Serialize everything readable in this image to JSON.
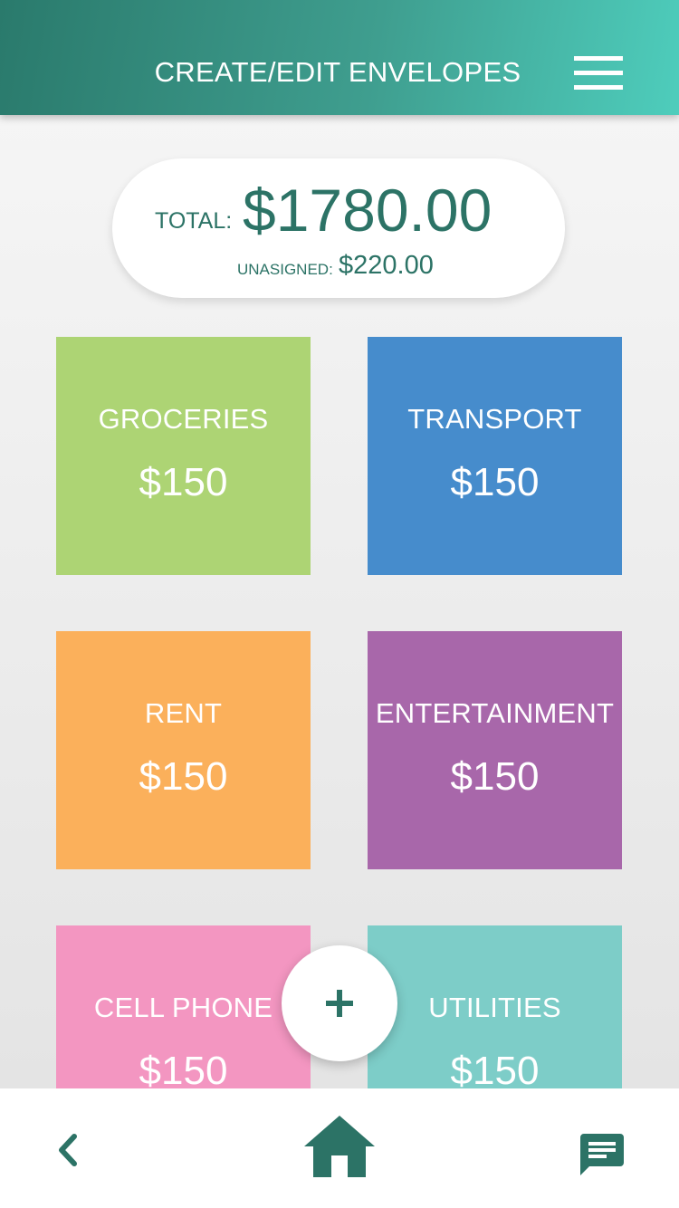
{
  "header": {
    "title": "CREATE/EDIT ENVELOPES",
    "menu_icon": "hamburger-menu-icon"
  },
  "summary": {
    "total_label": "TOTAL:",
    "total_value": "$1780.00",
    "unassigned_label": "UNASIGNED:",
    "unassigned_value": "$220.00"
  },
  "envelopes": [
    {
      "name": "GROCERIES",
      "amount": "$150",
      "color": "#add474"
    },
    {
      "name": "TRANSPORT",
      "amount": "$150",
      "color": "#468ccc"
    },
    {
      "name": "RENT",
      "amount": "$150",
      "color": "#fbb05b"
    },
    {
      "name": "ENTERTAINMENT",
      "amount": "$150",
      "color": "#a867aa"
    },
    {
      "name": "CELL PHONE",
      "amount": "$150",
      "color": "#f396c1"
    },
    {
      "name": "UTILITIES",
      "amount": "$150",
      "color": "#7dcdc8"
    }
  ],
  "fab": {
    "icon": "plus-icon"
  },
  "bottom_nav": {
    "back_icon": "chevron-left-icon",
    "home_icon": "home-icon",
    "chat_icon": "chat-icon"
  },
  "colors": {
    "accent": "#2c7366",
    "header_start": "#2a7a6c",
    "header_end": "#4ecdbc"
  }
}
